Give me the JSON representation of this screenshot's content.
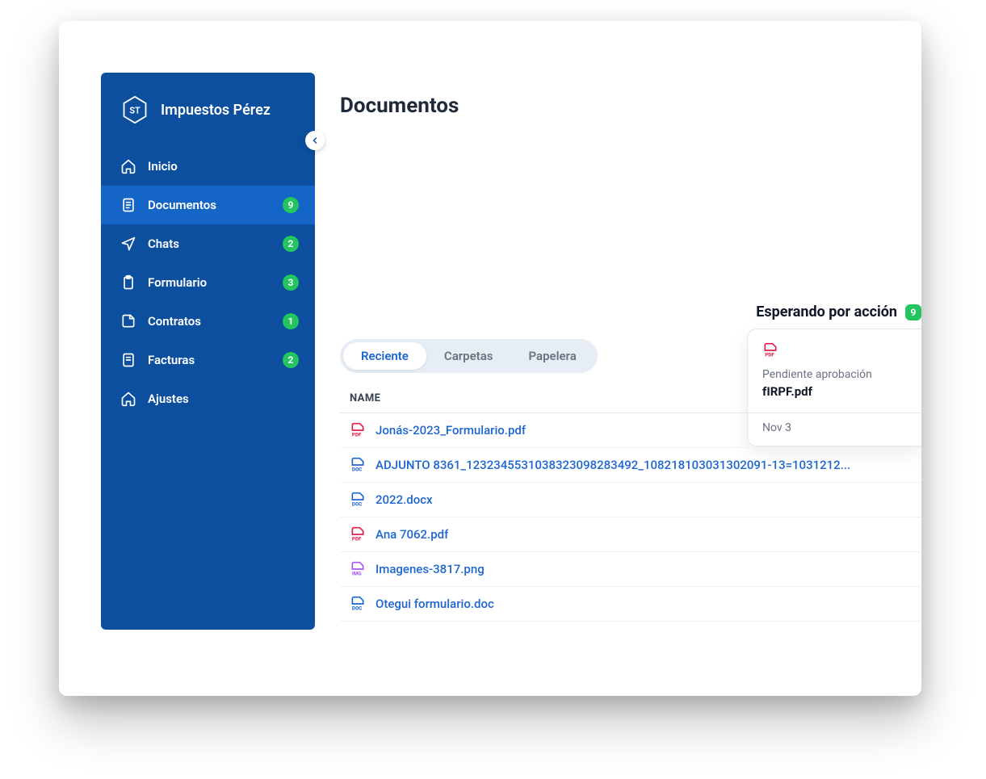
{
  "brand": {
    "name": "Impuestos Pérez",
    "logo_text": "ST"
  },
  "sidebar": {
    "items": [
      {
        "label": "Inicio",
        "icon": "home-icon",
        "badge": null
      },
      {
        "label": "Documentos",
        "icon": "document-icon",
        "badge": "9",
        "active": true
      },
      {
        "label": "Chats",
        "icon": "send-icon",
        "badge": "2"
      },
      {
        "label": "Formulario",
        "icon": "clipboard-icon",
        "badge": "3"
      },
      {
        "label": "Contratos",
        "icon": "file-save-icon",
        "badge": "1"
      },
      {
        "label": "Facturas",
        "icon": "receipt-icon",
        "badge": "2"
      },
      {
        "label": "Ajustes",
        "icon": "home-icon",
        "badge": null
      }
    ]
  },
  "page": {
    "title": "Documentos"
  },
  "waiting": {
    "title": "Esperando por acción",
    "badge": "9",
    "status": "Pendiente aprobación",
    "file": "fIRPF.pdf",
    "date": "Nov 3",
    "icon_type": "pdf"
  },
  "tabs": [
    {
      "label": "Reciente",
      "active": true
    },
    {
      "label": "Carpetas"
    },
    {
      "label": "Papelera"
    }
  ],
  "table": {
    "header": "NAME",
    "rows": [
      {
        "type": "pdf",
        "name": "Jonás-2023_Formulario.pdf"
      },
      {
        "type": "doc",
        "name": "ADJUNTO 8361_123234553103832309828​3492_108218103031302091-13=1031212..."
      },
      {
        "type": "doc",
        "name": "2022.docx"
      },
      {
        "type": "pdf",
        "name": "Ana 7062.pdf"
      },
      {
        "type": "img",
        "name": "Imagenes-3817.png"
      },
      {
        "type": "doc",
        "name": "Otegui formulario.doc"
      }
    ]
  }
}
